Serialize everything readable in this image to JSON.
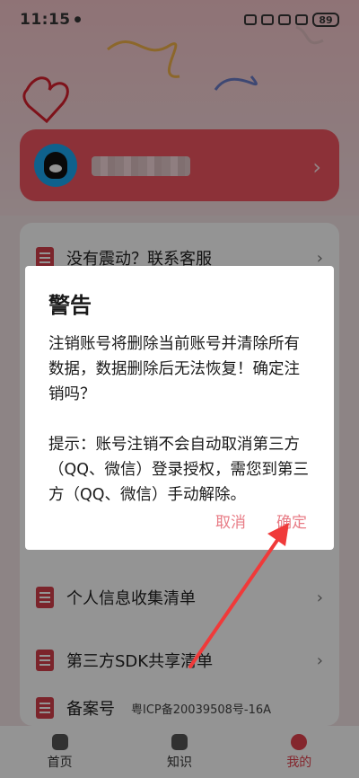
{
  "status_bar": {
    "time": "11:15",
    "battery": "89"
  },
  "profile": {
    "chevron": "›"
  },
  "menu": {
    "items": [
      {
        "label": "没有震动？联系客服",
        "extra": ""
      },
      {
        "label": "个人信息收集清单",
        "extra": ""
      },
      {
        "label": "第三方SDK共享清单",
        "extra": ""
      },
      {
        "label": "备案号",
        "extra": "粤ICP备20039508号-16A"
      }
    ],
    "chevron": "›"
  },
  "dialog": {
    "title": "警告",
    "body": "注销账号将删除当前账号并清除所有数据，数据删除后无法恢复！确定注销吗？\n\n提示：账号注销不会自动取消第三方（QQ、微信）登录授权，需您到第三方（QQ、微信）手动解除。",
    "cancel_label": "取消",
    "confirm_label": "确定"
  },
  "tabbar": {
    "items": [
      {
        "label": "首页"
      },
      {
        "label": "知识"
      },
      {
        "label": "我的"
      }
    ]
  },
  "colors": {
    "accent": "#e3424e",
    "dialog_button": "#e87c86",
    "annotation_arrow": "#f03a3a"
  },
  "icons": [
    "qq-avatar-icon",
    "clipboard-icon",
    "home-icon",
    "book-icon",
    "profile-icon"
  ]
}
